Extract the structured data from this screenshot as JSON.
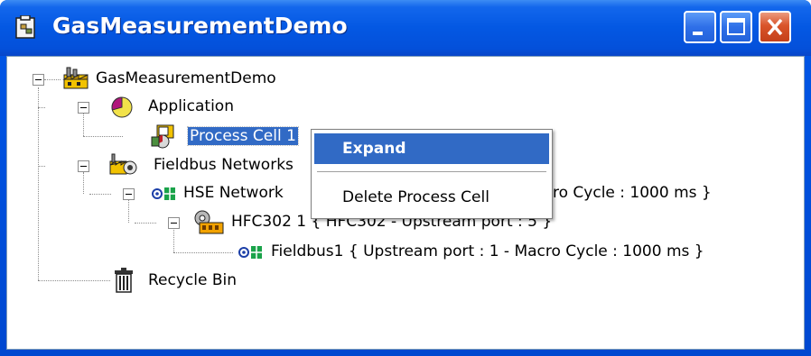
{
  "window": {
    "title": "GasMeasurementDemo"
  },
  "tree": {
    "root": {
      "label": "GasMeasurementDemo"
    },
    "application": {
      "label": "Application"
    },
    "process_cell": {
      "label": "Process Cell 1"
    },
    "fieldbus_networks": {
      "label": "Fieldbus Networks"
    },
    "hse_network": {
      "label": "HSE Network",
      "suffix": "ro Cycle : 1000 ms }"
    },
    "hfc302": {
      "label": "HFC302 1 { HFC302 - Upstream port : 5 }"
    },
    "fieldbus1": {
      "label": "Fieldbus1 { Upstream port : 1 - Macro Cycle : 1000 ms }"
    },
    "recycle_bin": {
      "label": "Recycle Bin"
    }
  },
  "context_menu": {
    "items": [
      {
        "label": "Expand",
        "highlighted": true
      },
      {
        "label": "Delete Process Cell",
        "highlighted": false
      }
    ]
  },
  "colors": {
    "titlebar": "#0458e3",
    "selection": "#316ac5",
    "close_button": "#d9542a"
  }
}
